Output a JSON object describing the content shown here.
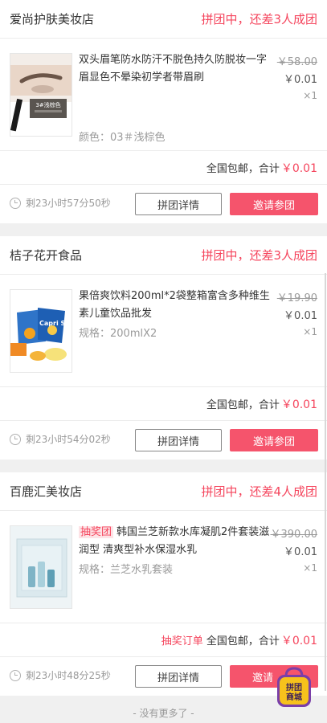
{
  "orders": [
    {
      "shop_name": "爱尚护肤美妆店",
      "status": "拼团中，还差3人成团",
      "title": "双头眉笔防水防汗不脱色持久防脱妆一字眉显色不晕染初学者带眉刷",
      "tag": "",
      "spec": "颜色：03＃浅棕色",
      "original_price": "￥58.00",
      "price": "￥0.01",
      "qty": "×1",
      "summary_prefix": "",
      "summary_text": "全国包邮，合计",
      "summary_amount": "￥0.01",
      "timer": "剩23小时57分50秒",
      "detail_label": "拼团详情",
      "invite_label": "邀请参团",
      "thumb_caption": "3#浅棕色"
    },
    {
      "shop_name": "桔子花开食品",
      "status": "拼团中，还差3人成团",
      "title": "果倍爽饮料200ml*2袋整箱富含多种维生素儿童饮品批发",
      "tag": "",
      "spec": "规格：200mlX2",
      "original_price": "￥19.90",
      "price": "￥0.01",
      "qty": "×1",
      "summary_prefix": "",
      "summary_text": "全国包邮，合计",
      "summary_amount": "￥0.01",
      "timer": "剩23小时54分02秒",
      "detail_label": "拼团详情",
      "invite_label": "邀请参团",
      "thumb_caption": "Capri Sun"
    },
    {
      "shop_name": "百鹿汇美妆店",
      "status": "拼团中，还差4人成团",
      "title": "韩国兰芝新款水库凝肌2件套装滋润型 清爽型补水保湿水乳",
      "tag": "抽奖团",
      "spec": "规格：兰芝水乳套装",
      "original_price": "￥390.00",
      "price": "￥0.01",
      "qty": "×1",
      "summary_prefix": "抽奖订单",
      "summary_text": "全国包邮，合计",
      "summary_amount": "￥0.01",
      "timer": "剩23小时48分25秒",
      "detail_label": "拼团详情",
      "invite_label": "邀请",
      "thumb_caption": ""
    }
  ],
  "no_more": "- 没有更多了 -",
  "float_badge": {
    "line1": "拼团",
    "line2": "商城"
  },
  "colors": {
    "accent": "#f5455d",
    "button": "#f5546c",
    "badge_bg": "#f6c21c",
    "badge_inner": "#7a3fa8"
  },
  "icons": {
    "timer": "clock-icon"
  }
}
